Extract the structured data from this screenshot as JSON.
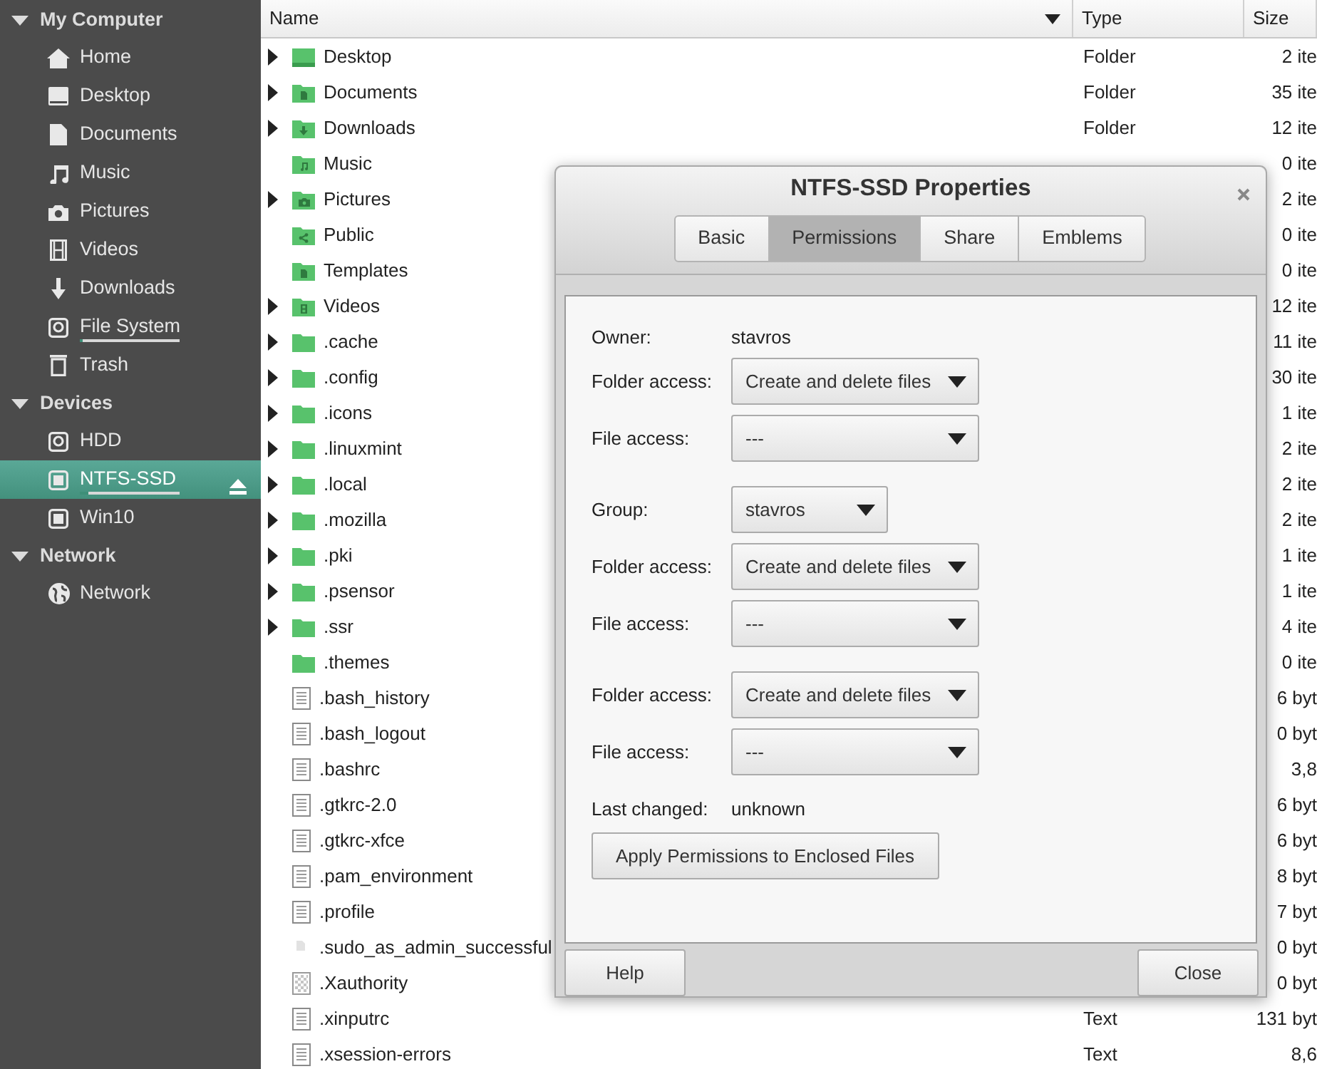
{
  "sidebar": {
    "sections": [
      {
        "title": "My Computer",
        "expanded": true,
        "items": [
          {
            "label": "Home",
            "kind": "home",
            "selected": false,
            "ejectable": false
          },
          {
            "label": "Desktop",
            "kind": "desktop",
            "selected": false,
            "ejectable": false
          },
          {
            "label": "Documents",
            "kind": "documents",
            "selected": false,
            "ejectable": false
          },
          {
            "label": "Music",
            "kind": "music",
            "selected": false,
            "ejectable": false
          },
          {
            "label": "Pictures",
            "kind": "pictures",
            "selected": false,
            "ejectable": false
          },
          {
            "label": "Videos",
            "kind": "videos",
            "selected": false,
            "ejectable": false
          },
          {
            "label": "Downloads",
            "kind": "downloads",
            "selected": false,
            "ejectable": false
          },
          {
            "label": "File System",
            "kind": "drive",
            "selected": false,
            "ejectable": false,
            "level": 0.03
          },
          {
            "label": "Trash",
            "kind": "trash",
            "selected": false,
            "ejectable": false
          }
        ]
      },
      {
        "title": "Devices",
        "expanded": true,
        "items": [
          {
            "label": "HDD",
            "kind": "drive",
            "selected": false,
            "ejectable": false
          },
          {
            "label": "NTFS-SSD",
            "kind": "ssd",
            "selected": true,
            "ejectable": true,
            "level": 0.08
          },
          {
            "label": "Win10",
            "kind": "ssd",
            "selected": false,
            "ejectable": false
          }
        ]
      },
      {
        "title": "Network",
        "expanded": true,
        "items": [
          {
            "label": "Network",
            "kind": "network",
            "selected": false,
            "ejectable": false
          }
        ]
      }
    ]
  },
  "file_list": {
    "columns": [
      "Name",
      "Type",
      "Size"
    ],
    "rows": [
      {
        "name": "Desktop",
        "kind": "desktop",
        "expandable": true,
        "type": "Folder",
        "size": "2 ite"
      },
      {
        "name": "Documents",
        "kind": "documents",
        "expandable": true,
        "type": "Folder",
        "size": "35 ite"
      },
      {
        "name": "Downloads",
        "kind": "downloads",
        "expandable": true,
        "type": "Folder",
        "size": "12 ite"
      },
      {
        "name": "Music",
        "kind": "music",
        "expandable": false,
        "size": "0 ite"
      },
      {
        "name": "Pictures",
        "kind": "pictures",
        "expandable": true,
        "size": "2 ite"
      },
      {
        "name": "Public",
        "kind": "public",
        "expandable": false,
        "size": "0 ite"
      },
      {
        "name": "Templates",
        "kind": "templates",
        "expandable": false,
        "size": "0 ite"
      },
      {
        "name": "Videos",
        "kind": "videos",
        "expandable": true,
        "size": "12 ite"
      },
      {
        "name": ".cache",
        "kind": "folder",
        "expandable": true,
        "size": "11 ite"
      },
      {
        "name": ".config",
        "kind": "folder",
        "expandable": true,
        "size": "30 ite"
      },
      {
        "name": ".icons",
        "kind": "folder",
        "expandable": true,
        "size": "1 ite"
      },
      {
        "name": ".linuxmint",
        "kind": "folder",
        "expandable": true,
        "size": "2 ite"
      },
      {
        "name": ".local",
        "kind": "folder",
        "expandable": true,
        "size": "2 ite"
      },
      {
        "name": ".mozilla",
        "kind": "folder",
        "expandable": true,
        "size": "2 ite"
      },
      {
        "name": ".pki",
        "kind": "folder",
        "expandable": true,
        "size": "1 ite"
      },
      {
        "name": ".psensor",
        "kind": "folder",
        "expandable": true,
        "size": "1 ite"
      },
      {
        "name": ".ssr",
        "kind": "folder",
        "expandable": true,
        "size": "4 ite"
      },
      {
        "name": ".themes",
        "kind": "folder",
        "expandable": false,
        "size": "0 ite"
      },
      {
        "name": ".bash_history",
        "kind": "text",
        "expandable": false,
        "size": "6 byt"
      },
      {
        "name": ".bash_logout",
        "kind": "text",
        "expandable": false,
        "size": "0 byt"
      },
      {
        "name": ".bashrc",
        "kind": "text",
        "expandable": false,
        "size": "3,8"
      },
      {
        "name": ".gtkrc-2.0",
        "kind": "text",
        "expandable": false,
        "size": "6 byt"
      },
      {
        "name": ".gtkrc-xfce",
        "kind": "text",
        "expandable": false,
        "size": "6 byt"
      },
      {
        "name": ".pam_environment",
        "kind": "text",
        "expandable": false,
        "size": "8 byt"
      },
      {
        "name": ".profile",
        "kind": "text",
        "expandable": false,
        "size": "7 byt"
      },
      {
        "name": ".sudo_as_admin_successful",
        "kind": "empty",
        "expandable": false,
        "size": "0 byt"
      },
      {
        "name": ".Xauthority",
        "kind": "binary",
        "expandable": false,
        "size": "0 byt"
      },
      {
        "name": ".xinputrc",
        "kind": "text",
        "expandable": false,
        "type": "Text",
        "size": "131 byt"
      },
      {
        "name": ".xsession-errors",
        "kind": "text",
        "expandable": false,
        "type": "Text",
        "size": "8,6"
      }
    ]
  },
  "dialog": {
    "title": "NTFS-SSD Properties",
    "tabs": [
      {
        "label": "Basic",
        "selected": false
      },
      {
        "label": "Permissions",
        "selected": true
      },
      {
        "label": "Share",
        "selected": false
      },
      {
        "label": "Emblems",
        "selected": false
      }
    ],
    "sections": [
      {
        "rows": [
          {
            "kind": "text",
            "label": "Owner:",
            "value": "stavros"
          },
          {
            "kind": "combo",
            "label": "Folder access:",
            "value": "Create and delete files"
          },
          {
            "kind": "combo",
            "label": "File access:",
            "value": "---"
          }
        ]
      },
      {
        "rows": [
          {
            "kind": "shortcombo",
            "label": "Group:",
            "value": "stavros"
          },
          {
            "kind": "combo",
            "label": "Folder access:",
            "value": "Create and delete files"
          },
          {
            "kind": "combo",
            "label": "File access:",
            "value": "---"
          }
        ]
      },
      {
        "rows": [
          {
            "kind": "combo",
            "label": "Folder access:",
            "value": "Create and delete files"
          },
          {
            "kind": "combo",
            "label": "File access:",
            "value": "---"
          }
        ]
      }
    ],
    "last_changed": {
      "label": "Last changed:",
      "value": "unknown"
    },
    "apply_button": "Apply Permissions to Enclosed Files",
    "buttons": [
      "Help",
      "Close"
    ]
  }
}
